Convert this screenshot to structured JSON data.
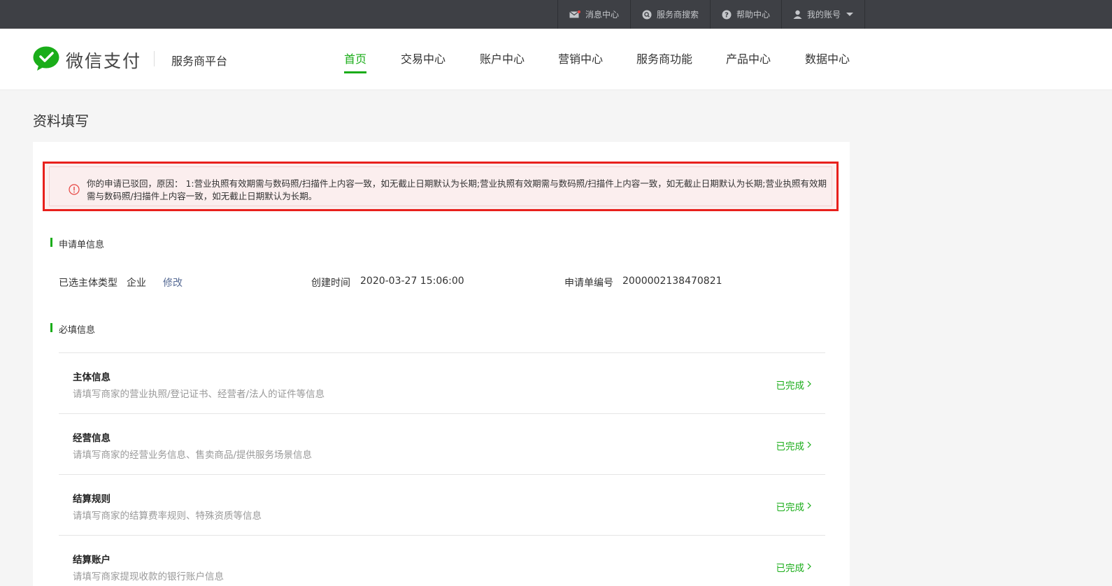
{
  "topbar": {
    "items": [
      {
        "label": "消息中心",
        "icon": "mail-icon"
      },
      {
        "label": "服务商搜索",
        "icon": "search-icon"
      },
      {
        "label": "帮助中心",
        "icon": "help-icon"
      },
      {
        "label": "我的账号",
        "icon": "user-icon"
      }
    ]
  },
  "header": {
    "logo_text": "微信支付",
    "platform": "服务商平台",
    "nav": [
      "首页",
      "交易中心",
      "账户中心",
      "营销中心",
      "服务商功能",
      "产品中心",
      "数据中心"
    ],
    "active_nav": "首页"
  },
  "page": {
    "title": "资料填写"
  },
  "alert": {
    "text": "你的申请已驳回，原因： 1:营业执照有效期需与数码照/扫描件上内容一致，如无截止日期默认为长期;营业执照有效期需与数码照/扫描件上内容一致，如无截止日期默认为长期;营业执照有效期需与数码照/扫描件上内容一致，如无截止日期默认为长期。"
  },
  "application_info": {
    "section_title": "申请单信息",
    "entity_type_label": "已选主体类型",
    "entity_type_value": "企业",
    "modify_link": "修改",
    "created_label": "创建时间",
    "created_value": "2020-03-27 15:06:00",
    "number_label": "申请单编号",
    "number_value": "2000002138470821"
  },
  "required_info": {
    "section_title": "必填信息",
    "items": [
      {
        "title": "主体信息",
        "desc": "请填写商家的营业执照/登记证书、经营者/法人的证件等信息",
        "status": "已完成"
      },
      {
        "title": "经营信息",
        "desc": "请填写商家的经营业务信息、售卖商品/提供服务场景信息",
        "status": "已完成"
      },
      {
        "title": "结算规则",
        "desc": "请填写商家的结算费率规则、特殊资质等信息",
        "status": "已完成"
      },
      {
        "title": "结算账户",
        "desc": "请填写商家提现收款的银行账户信息",
        "status": "已完成"
      }
    ]
  },
  "colors": {
    "brand_green": "#1aad19",
    "alert_border": "#e8201c",
    "alert_bg": "#fbeeee",
    "link_blue": "#576b95",
    "topbar_bg": "#3e4045"
  }
}
